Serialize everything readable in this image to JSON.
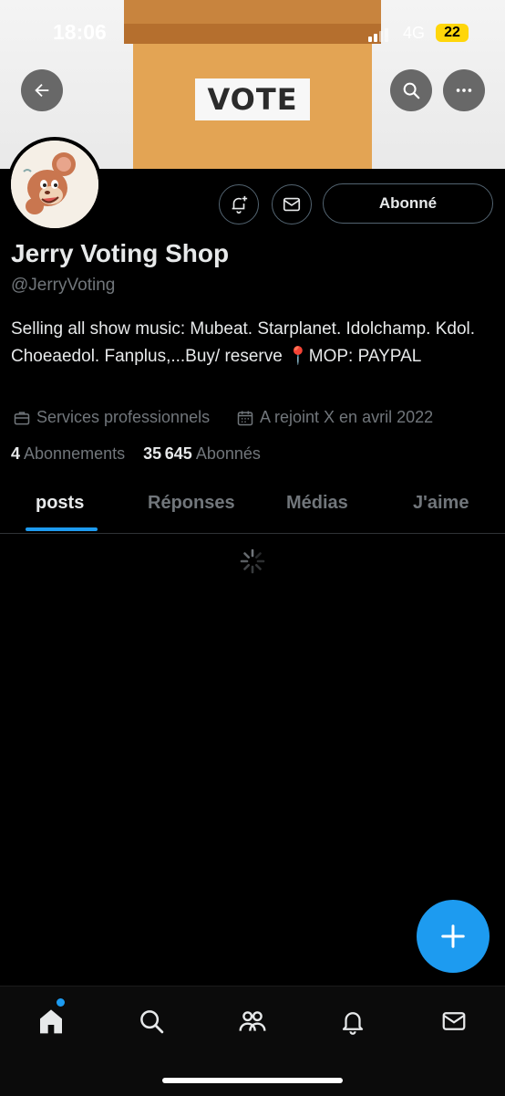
{
  "status_bar": {
    "time": "18:06",
    "network": "4G",
    "battery": "22"
  },
  "banner": {
    "label": "VOTE"
  },
  "header": {
    "back_icon": "arrow-left-icon",
    "search_icon": "search-icon",
    "more_icon": "more-horizontal-icon"
  },
  "profile": {
    "name": "Jerry Voting Shop",
    "handle": "@JerryVoting",
    "bio": "Selling all show music: Mubeat. Starplanet. Idolchamp. Kdol. Choeaedol. Fanplus,...Buy/ reserve 📍MOP: PAYPAL",
    "category": "Services professionnels",
    "joined": "A rejoint X en avril 2022",
    "following_count": "4",
    "following_label": "Abonnements",
    "followers_count": "35 645",
    "followers_label": "Abonnés",
    "follow_button": "Abonné"
  },
  "tabs": [
    {
      "label": "posts",
      "active": true
    },
    {
      "label": "Réponses",
      "active": false
    },
    {
      "label": "Médias",
      "active": false
    },
    {
      "label": "J'aime",
      "active": false
    }
  ],
  "colors": {
    "accent": "#1d9bf0",
    "background": "#000000",
    "muted": "#71767b"
  },
  "bottom_nav": [
    "home-icon",
    "search-icon",
    "communities-icon",
    "notifications-icon",
    "messages-icon"
  ]
}
